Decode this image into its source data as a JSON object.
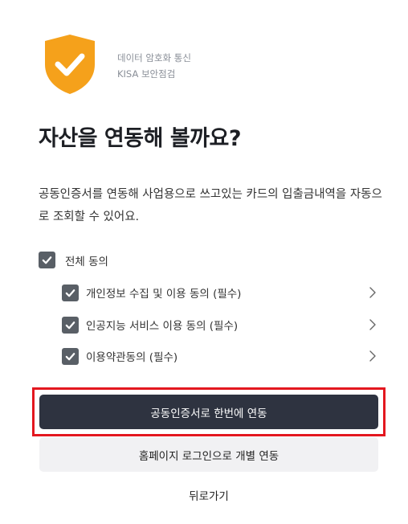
{
  "security": {
    "line1": "데이터 암호화 통신",
    "line2": "KISA 보안점검",
    "shield_color": "#f5a11b"
  },
  "title": "자산을 연동해 볼까요?",
  "description": "공동인증서를 연동해 사업용으로 쓰고있는 카드의 입출금내역을 자동으로 조회할 수 있어요.",
  "consent": {
    "all_label": "전체 동의",
    "all_checked": true,
    "items": [
      {
        "label": "개인정보 수집 및 이용 동의 (필수)",
        "checked": true
      },
      {
        "label": "인공지능 서비스 이용 동의 (필수)",
        "checked": true
      },
      {
        "label": "이용약관동의 (필수)",
        "checked": true
      }
    ]
  },
  "buttons": {
    "primary": "공동인증서로 한번에 연동",
    "secondary": "홈페이지 로그인으로 개별 연동",
    "back": "뒤로가기"
  },
  "colors": {
    "primary_button": "#2e3340",
    "highlight_border": "#e3171f",
    "checkbox": "#595f66"
  }
}
